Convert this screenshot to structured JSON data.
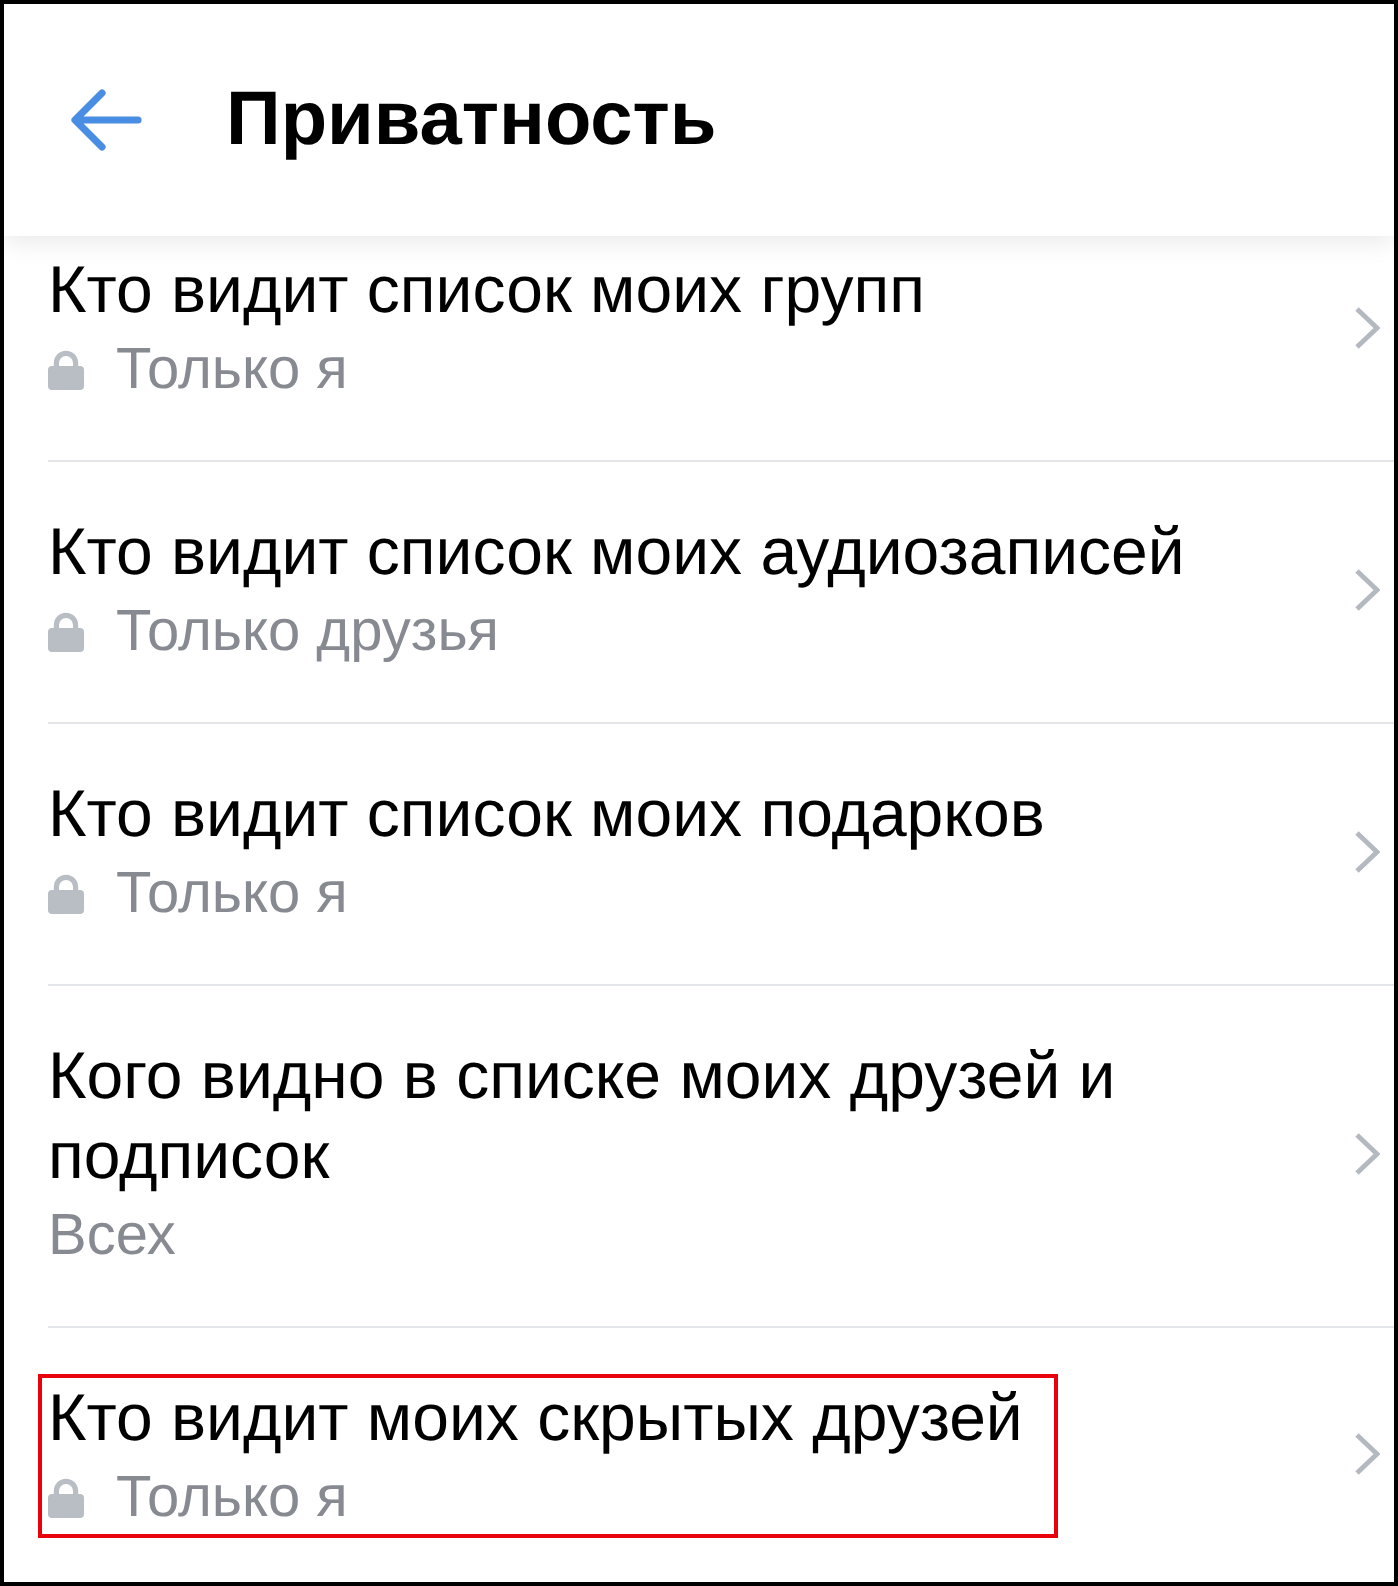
{
  "header": {
    "title": "Приватность"
  },
  "settings": [
    {
      "title": "Кто видит список моих групп",
      "value": "Только я",
      "locked": true,
      "highlighted": false
    },
    {
      "title": "Кто видит список моих аудиозаписей",
      "value": "Только друзья",
      "locked": true,
      "highlighted": false
    },
    {
      "title": "Кто видит список моих подарков",
      "value": "Только я",
      "locked": true,
      "highlighted": false
    },
    {
      "title": "Кого видно в списке моих друзей и подписок",
      "value": "Всех",
      "locked": false,
      "highlighted": false
    },
    {
      "title": "Кто видит моих скрытых друзей",
      "value": "Только я",
      "locked": true,
      "highlighted": true
    }
  ]
}
